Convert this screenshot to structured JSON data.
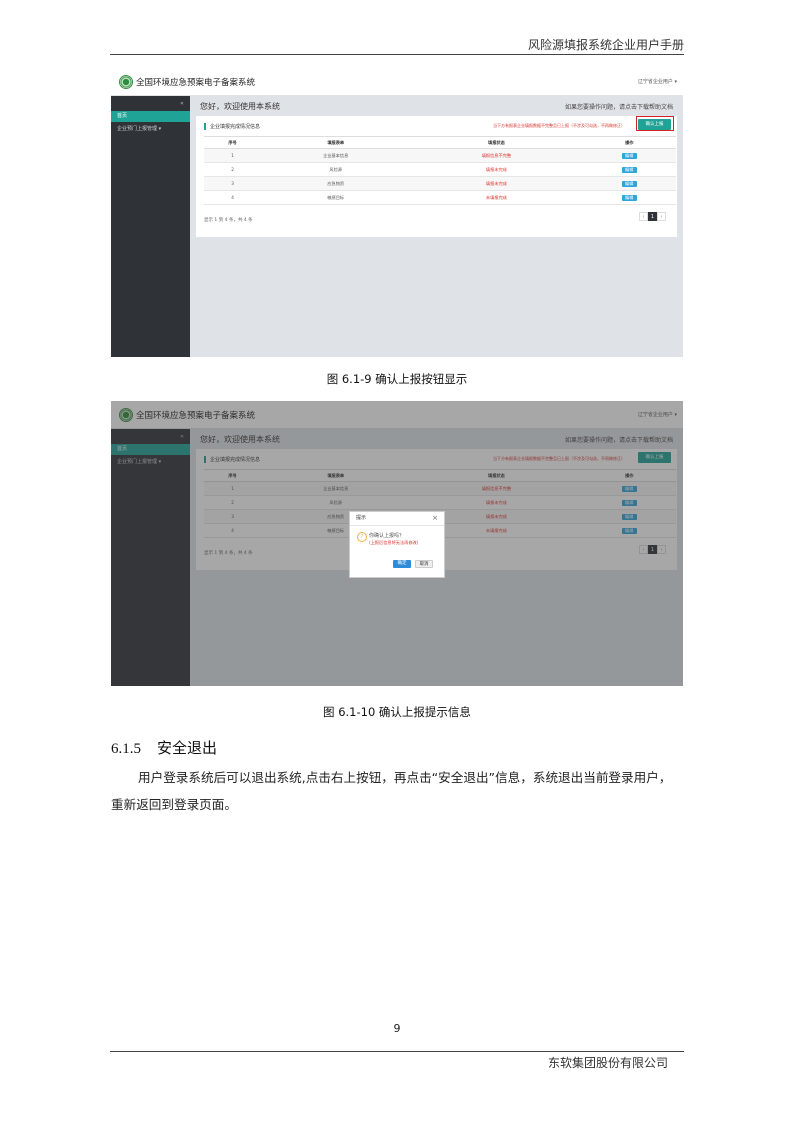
{
  "header": {
    "doc_title": "风险源填报系统企业用户手册"
  },
  "screenshots": [
    {
      "app_title": "全国环境应急预案电子备案系统",
      "user_menu": "辽宁省企业用户 ▾",
      "sidebar": {
        "collapse_icon": "«",
        "items": [
          "首页",
          "企业预门上报管理 ▾"
        ]
      },
      "welcome": "您好，欢迎使用本系统",
      "hint": "如果您要操作问题，请点击下载帮助文档",
      "panel_title": "企业填报完成情况信息",
      "warning": "当下方有报表企业填报数据不完整且已上报（不涉及可勾选，不再做修正）",
      "confirm_button": "确认上报",
      "table_headers": [
        "序号",
        "填报表单",
        "填报状态",
        "操作"
      ],
      "rows": [
        {
          "no": "1",
          "name": "企业基本信息",
          "status": "填报信息不完整",
          "action": "编辑"
        },
        {
          "no": "2",
          "name": "风险源",
          "status": "填报未完成",
          "action": "编辑"
        },
        {
          "no": "3",
          "name": "应急物资",
          "status": "填报未完成",
          "action": "编辑"
        },
        {
          "no": "4",
          "name": "敏感目标",
          "status": "未填报完成",
          "action": "编辑"
        }
      ],
      "page_info": "显示 1 到 4 条，共 4 条",
      "pager": [
        "‹",
        "1",
        "›"
      ]
    },
    {
      "app_title": "全国环境应急预案电子备案系统",
      "user_menu": "辽宁省企业用户 ▾",
      "sidebar": {
        "collapse_icon": "«",
        "items": [
          "首页",
          "企业预门上报管理 ▾"
        ]
      },
      "welcome": "您好，欢迎使用本系统",
      "hint": "如果您要操作问题，请点击下载帮助文档",
      "panel_title": "企业填报完成情况信息",
      "warning": "当下方有报表企业填报数据不完整且已上报（不涉及可勾选，不再做修正）",
      "confirm_button": "确认上报",
      "table_headers": [
        "序号",
        "填报表单",
        "填报状态",
        "操作"
      ],
      "rows": [
        {
          "no": "1",
          "name": "企业基本信息",
          "status": "填报信息不完整",
          "action": "编辑"
        },
        {
          "no": "2",
          "name": "风险源",
          "status": "填报未完成",
          "action": "编辑"
        },
        {
          "no": "3",
          "name": "应急物资",
          "status": "填报未完成",
          "action": "编辑"
        },
        {
          "no": "4",
          "name": "敏感目标",
          "status": "未填报完成",
          "action": "编辑"
        }
      ],
      "page_info": "显示 1 到 4 条，共 4 条",
      "pager": [
        "‹",
        "1",
        "›"
      ],
      "dialog": {
        "title": "提示",
        "close": "×",
        "icon": "?",
        "question": "你确认上报吗？",
        "note": "(上报后信息将无法再修改)",
        "ok": "确定",
        "cancel": "取消"
      }
    }
  ],
  "captions": [
    "图 6.1-9 确认上报按钮显示",
    "图 6.1-10 确认上报提示信息"
  ],
  "section": {
    "number": "6.1.5",
    "title": "安全退出",
    "paragraph": "用户登录系统后可以退出系统,点击右上按钮，再点击“安全退出”信息，系统退出当前登录用户，重新返回到登录页面。"
  },
  "page_number": "9",
  "footer": {
    "company": "东软集团股份有限公司"
  }
}
